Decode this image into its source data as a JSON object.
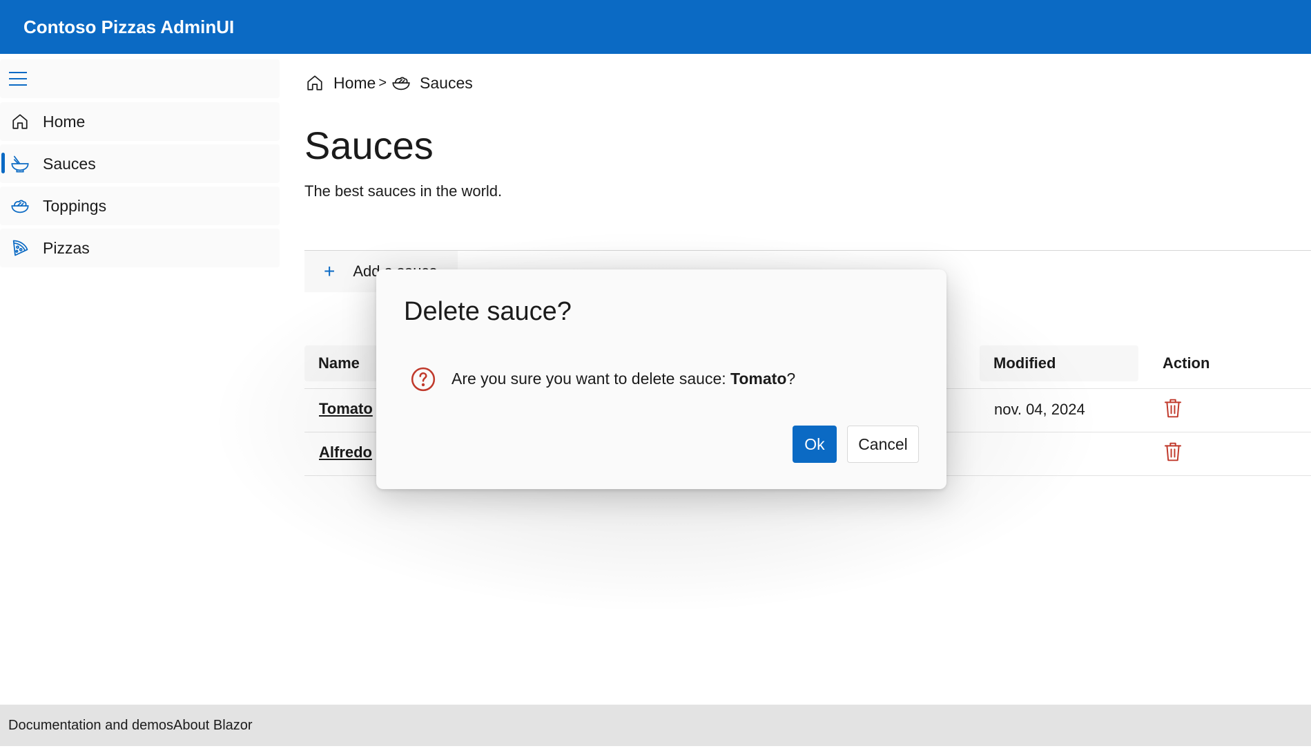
{
  "app": {
    "title": "Contoso Pizzas AdminUI"
  },
  "sidebar": {
    "menu_icon": "hamburger-icon",
    "items": [
      {
        "label": "Home",
        "icon": "home-icon",
        "active": false
      },
      {
        "label": "Sauces",
        "icon": "bowl-icon",
        "active": true
      },
      {
        "label": "Toppings",
        "icon": "salad-icon",
        "active": false
      },
      {
        "label": "Pizzas",
        "icon": "pizza-slice-icon",
        "active": false
      }
    ]
  },
  "breadcrumb": {
    "home": "Home",
    "separator": ">",
    "current": "Sauces"
  },
  "page": {
    "title": "Sauces",
    "description": "The best sauces in the world."
  },
  "toolbar": {
    "add_label": "Add a sauce",
    "add_icon": "plus-icon"
  },
  "table": {
    "columns": [
      "Name",
      "Modified",
      "Action"
    ],
    "rows": [
      {
        "name": "Tomato",
        "modified": "nov. 04, 2024"
      },
      {
        "name": "Alfredo",
        "modified": ""
      }
    ]
  },
  "dialog": {
    "title": "Delete sauce?",
    "message_prefix": "Are you sure you want to delete sauce: ",
    "item_name": "Tomato",
    "message_suffix": "?",
    "ok_label": "Ok",
    "cancel_label": "Cancel",
    "icon": "question-circle-icon"
  },
  "footer": {
    "links": [
      "Documentation and demos",
      "About Blazor"
    ]
  },
  "colors": {
    "accent": "#0b6ac4",
    "danger": "#c0392b"
  }
}
